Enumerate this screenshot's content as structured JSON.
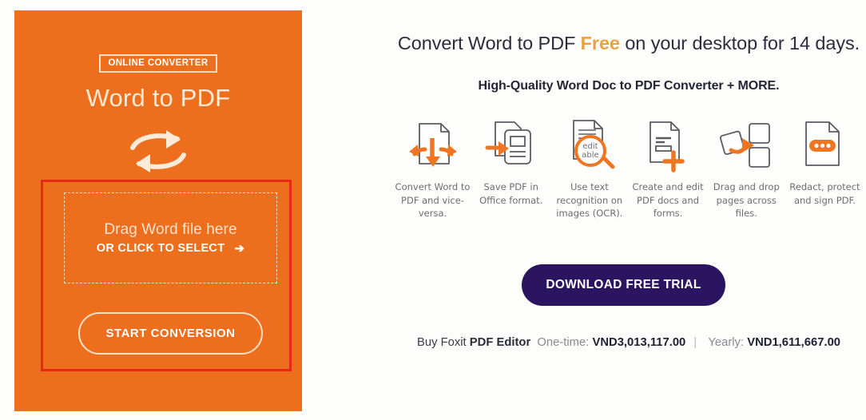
{
  "colors": {
    "orange": "#ED6E1C",
    "highlight_red": "#E62916",
    "purple": "#2B1460",
    "accent_gold": "#E8A33D",
    "icon_orange": "#EE7623",
    "icon_gray": "#6D6D74"
  },
  "converter": {
    "badge": "ONLINE CONVERTER",
    "title": "Word to PDF",
    "swap_icon": "swap-arrows-icon",
    "dropzone": {
      "line1": "Drag Word file here",
      "line2": "OR CLICK TO SELECT",
      "arrow": "➔"
    },
    "start_button": "START CONVERSION"
  },
  "promo": {
    "headline_before": "Convert Word to PDF ",
    "headline_highlight": "Free",
    "headline_after": " on your desktop for 14 days.",
    "subheadline": "High-Quality Word Doc to PDF Converter + MORE.",
    "download_button": "DOWNLOAD FREE TRIAL"
  },
  "features": [
    {
      "icon": "convert-doc-icon",
      "label": "Convert Word to PDF and vice-versa."
    },
    {
      "icon": "save-office-format-icon",
      "label": "Save PDF in Office format."
    },
    {
      "icon": "ocr-magnifier-icon",
      "label": "Use text recognition on images (OCR).",
      "badge_line1": "edit",
      "badge_line2": "able"
    },
    {
      "icon": "create-edit-doc-icon",
      "label": "Create and edit PDF docs and forms."
    },
    {
      "icon": "drag-drop-pages-icon",
      "label": "Drag and drop pages across files."
    },
    {
      "icon": "redact-protect-icon",
      "label": "Redact, protect and sign PDF."
    }
  ],
  "pricing": {
    "buy_label": "Buy Foxit",
    "product": "PDF Editor",
    "onetime_label": "One-time:",
    "onetime_price": "VND3,013,117.00",
    "separator": "|",
    "yearly_label": "Yearly:",
    "yearly_price": "VND1,611,667.00"
  }
}
